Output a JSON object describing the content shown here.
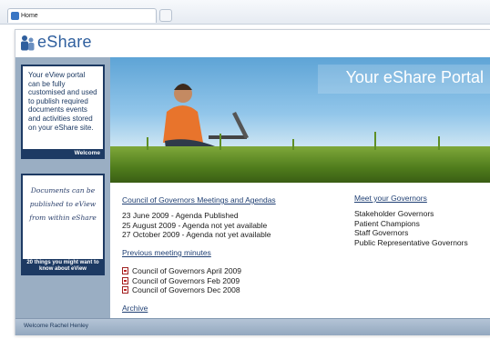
{
  "browser": {
    "tab_title": "Home"
  },
  "header": {
    "logo_text": "eShare"
  },
  "sidebar": {
    "box1_text": "Your eView portal can be fully customised and used to publish required documents events and activities stored on your eShare site.",
    "box1_bar": "Welcome",
    "box2_text": "Documents can be published to eView from within eShare",
    "box2_bar": "20 things you might want to know about eView"
  },
  "hero": {
    "title": "Your eShare Portal"
  },
  "meetings": {
    "heading": "Council of Governors Meetings and Agendas",
    "items": [
      "23 June 2009 - Agenda Published",
      "25 August 2009 - Agenda not yet available",
      "27 October 2009 - Agenda not yet available"
    ]
  },
  "previous": {
    "heading": "Previous meeting minutes",
    "items": [
      "Council of Governors April 2009",
      "Council of Governors Feb 2009",
      "Council of Governors Dec 2008"
    ],
    "archive": "Archive"
  },
  "governors": {
    "heading": "Meet your Governors",
    "items": [
      "Stakeholder Governors",
      "Patient Champions",
      "Staff Governors",
      "Public Representative Governors"
    ]
  },
  "footer": {
    "welcome": "Welcome Rachel Henley"
  }
}
